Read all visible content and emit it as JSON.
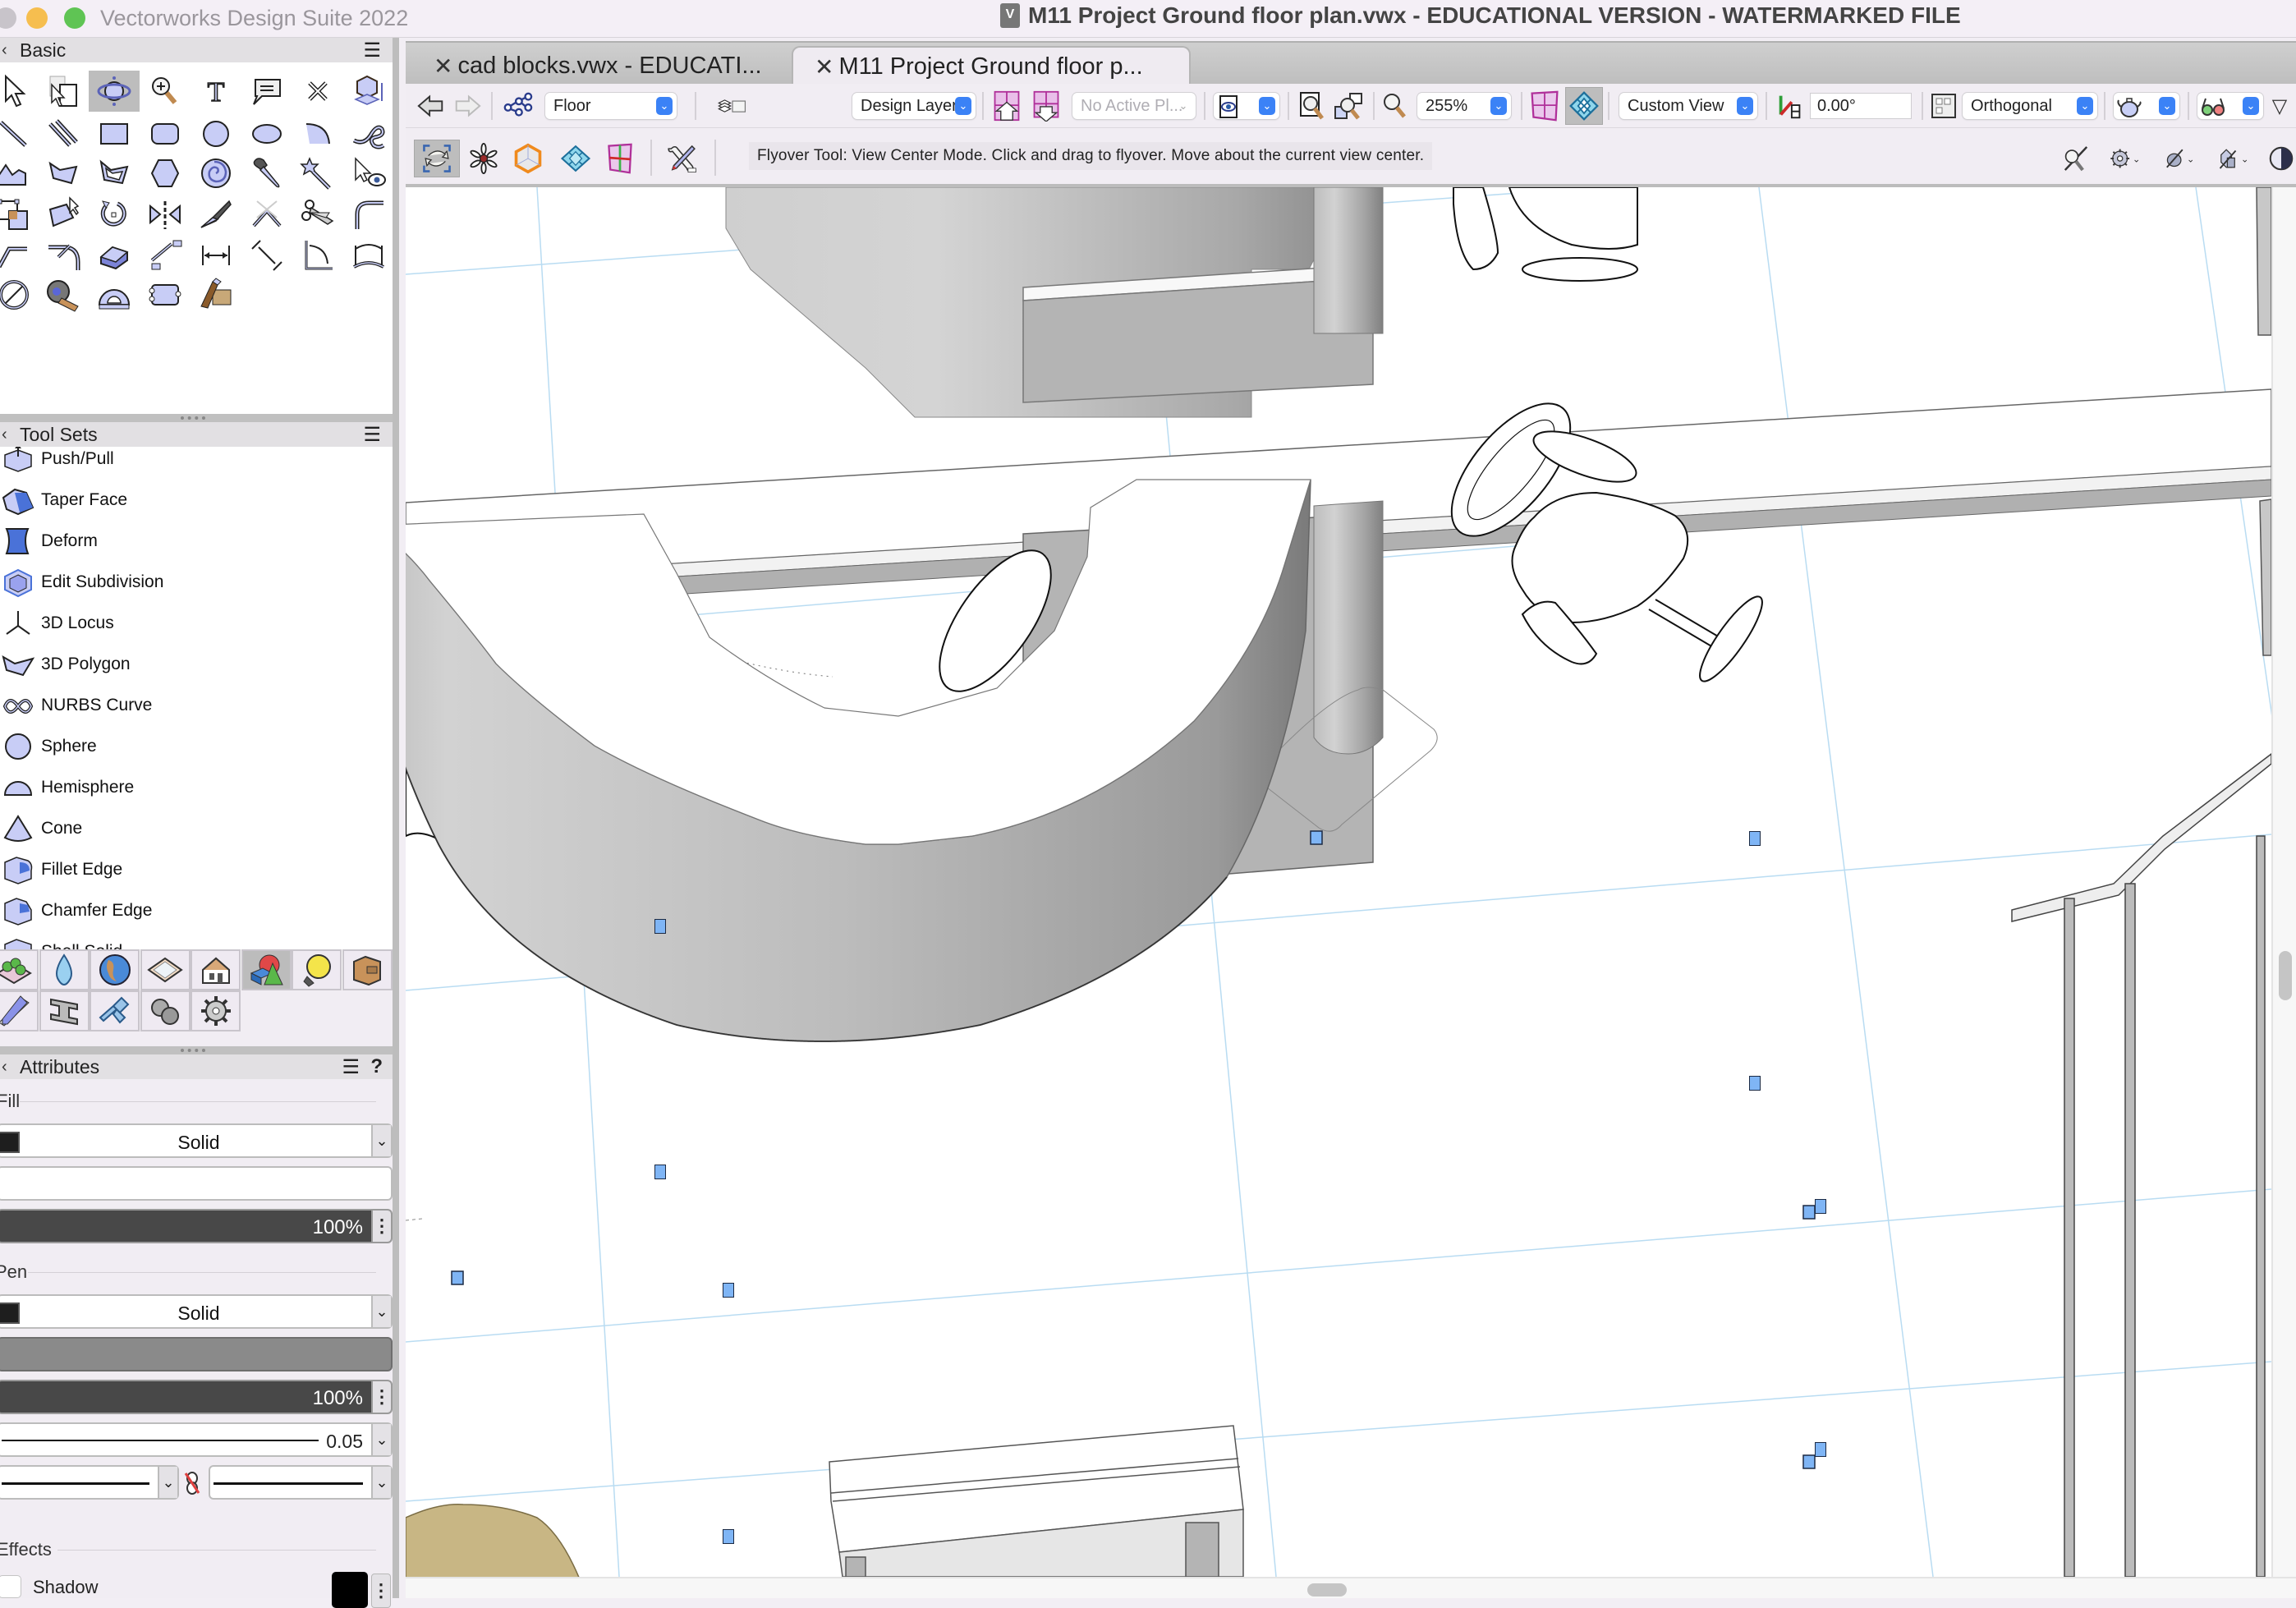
{
  "window": {
    "app_title": "Vectorworks Design Suite 2022",
    "document_title": "M11 Project Ground floor plan.vwx - EDUCATIONAL VERSION - WATERMARKED FILE",
    "traffic_lights": {
      "close": "#c8c4ca",
      "minimize": "#f6be4f",
      "zoom": "#5fc454"
    }
  },
  "tabs": [
    {
      "label": "cad blocks.vwx - EDUCATI...",
      "active": false,
      "close_icon": "x"
    },
    {
      "label": "M11 Project Ground floor p...",
      "active": true,
      "close_icon": "x"
    }
  ],
  "basic_palette": {
    "title": "Basic",
    "tools": [
      "selection",
      "2d-reshape-duplicate",
      "flyover",
      "zoom",
      "text",
      "callout",
      "locus",
      "unfold-to-plane",
      "line",
      "double-line",
      "rectangle",
      "rounded-rectangle",
      "circle",
      "oval",
      "arc",
      "freehand",
      "polyline",
      "polygon",
      "double-line-polygon",
      "regular-polygon",
      "spiral",
      "eyedropper",
      "visibility-wand",
      "visibility",
      "reshape",
      "2d-reshape",
      "rotate",
      "mirror",
      "split",
      "connect-combine",
      "trim",
      "fillet",
      "chamfer",
      "offset",
      "eraser",
      "move-by-points",
      "dimension",
      "angular-dimension",
      "angle",
      "arc-length",
      "diameter",
      "tape-measure",
      "protractor",
      "clip",
      "attribute-mapping"
    ],
    "active_tool": "flyover"
  },
  "tool_sets": {
    "title": "Tool Sets",
    "items": [
      {
        "label": "Push/Pull",
        "icon": "push-pull-icon"
      },
      {
        "label": "Taper Face",
        "icon": "taper-face-icon"
      },
      {
        "label": "Deform",
        "icon": "deform-icon"
      },
      {
        "label": "Edit Subdivision",
        "icon": "edit-subdivision-icon"
      },
      {
        "label": "3D Locus",
        "icon": "3d-locus-icon"
      },
      {
        "label": "3D Polygon",
        "icon": "3d-polygon-icon"
      },
      {
        "label": "NURBS Curve",
        "icon": "nurbs-curve-icon"
      },
      {
        "label": "Sphere",
        "icon": "sphere-icon"
      },
      {
        "label": "Hemisphere",
        "icon": "hemisphere-icon"
      },
      {
        "label": "Cone",
        "icon": "cone-icon"
      },
      {
        "label": "Fillet Edge",
        "icon": "fillet-edge-icon"
      },
      {
        "label": "Chamfer Edge",
        "icon": "chamfer-edge-icon"
      },
      {
        "label": "Shell Solid",
        "icon": "shell-solid-icon"
      }
    ],
    "set_buttons": [
      "site-planning",
      "landscape-water",
      "geo-globe",
      "survey-plan",
      "building-shell",
      "3d-modeling",
      "lighting",
      "furniture-cabinet",
      "dims-notes",
      "structural-beam",
      "plumbing-pipe",
      "detailing-fasteners",
      "machine-components"
    ],
    "active_set": "3d-modeling"
  },
  "attributes": {
    "title": "Attributes",
    "fill": {
      "section_label": "Fill",
      "style": "Solid",
      "swatch_color": "#1e1e1e",
      "opacity": "100%"
    },
    "pen": {
      "section_label": "Pen",
      "style": "Solid",
      "swatch_color": "#1e1e1e",
      "opacity": "100%",
      "thickness": "0.05"
    },
    "effects": {
      "section_label": "Effects",
      "shadow_label": "Shadow",
      "shadow_checked": false,
      "shadow_color": "#000000"
    }
  },
  "view_bar": {
    "class_select": "Floor",
    "layer_select": "Design Layer...",
    "plane_select": "No Active Pl...",
    "zoom_value": "255%",
    "view_select": "Custom View",
    "rotation_value": "0.00°",
    "projection_select": "Orthogonal"
  },
  "tool_bar": {
    "hint": "Flyover Tool: View Center Mode. Click and drag to flyover.  Move about the current view center.",
    "modes": [
      "view-center-mode",
      "working-plane-center-mode",
      "object-center-mode",
      "origin-center-mode",
      "plane-center-mode"
    ],
    "active_mode": "view-center-mode"
  },
  "canvas": {
    "background": "#ffffff",
    "grid_color": "#b9dcf2",
    "selection_handle_color": "#7fb5f5",
    "floor_object_color": "#c8b684"
  }
}
